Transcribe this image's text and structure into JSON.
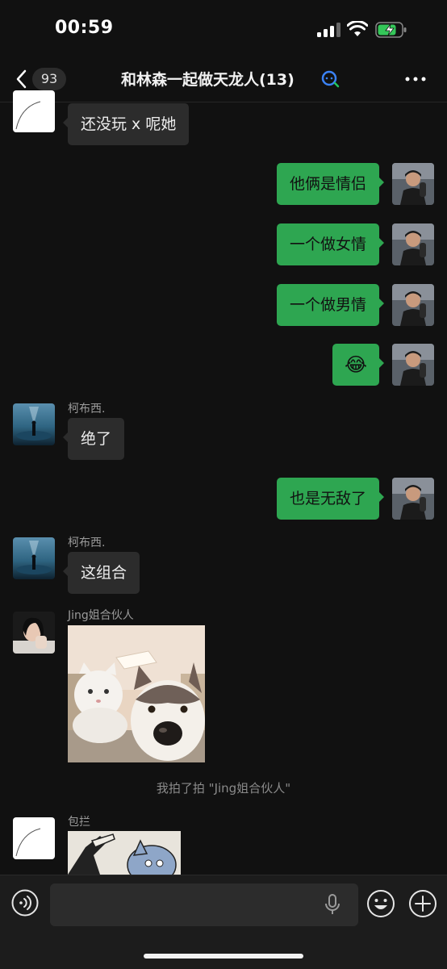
{
  "status_bar": {
    "time": "00:59"
  },
  "header": {
    "unread_count": "93",
    "title": "和林森一起做天龙人(13)"
  },
  "messages": [
    {
      "side": "in",
      "text": "还没玩 x 呢她"
    },
    {
      "side": "out",
      "text": "他俩是情侣"
    },
    {
      "side": "out",
      "text": "一个做女情"
    },
    {
      "side": "out",
      "text": "一个做男情"
    },
    {
      "side": "out",
      "emoji": "😂"
    },
    {
      "side": "in",
      "sender": "柯布西.",
      "text": "绝了"
    },
    {
      "side": "out",
      "text": "也是无敌了"
    },
    {
      "side": "in",
      "sender": "柯布西.",
      "text": "这组合"
    },
    {
      "side": "in",
      "sender": "Jing姐合伙人",
      "image": "cat-and-husky-photo"
    },
    {
      "side": "in",
      "sender": "包拦",
      "image": "cartoon-sticker"
    }
  ],
  "system_messages": [
    "我拍了拍 \"Jing姐合伙人\""
  ],
  "icons": {
    "back": "chevron-left-icon",
    "ai": "ai-search-icon",
    "more": "more-dots-icon",
    "voice": "voice-icon",
    "mic": "mic-icon",
    "emoji": "emoji-icon",
    "plus": "plus-icon"
  },
  "colors": {
    "background": "#111111",
    "outgoing_bubble": "#2ea651",
    "incoming_bubble": "#2c2c2c"
  }
}
